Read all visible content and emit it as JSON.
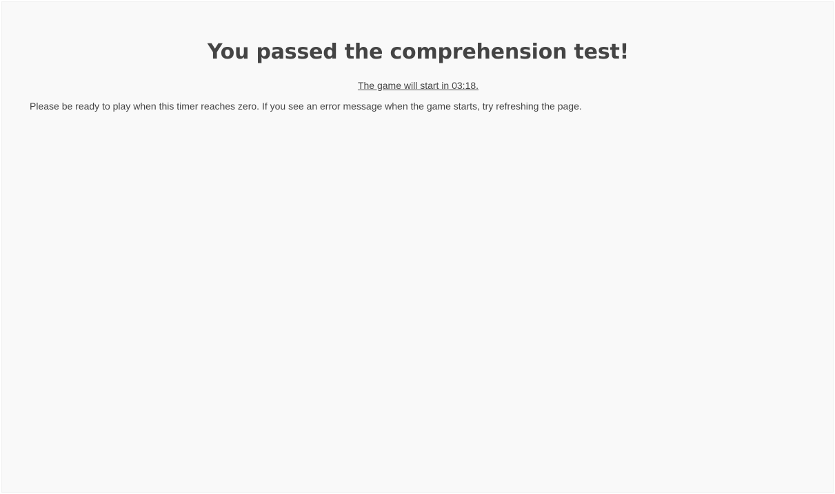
{
  "main": {
    "title": "You passed the comprehension test!",
    "timer_text": "The game will start in 03:18.",
    "instruction": "Please be ready to play when this timer reaches zero. If you see an error message when the game starts, try refreshing the page."
  }
}
